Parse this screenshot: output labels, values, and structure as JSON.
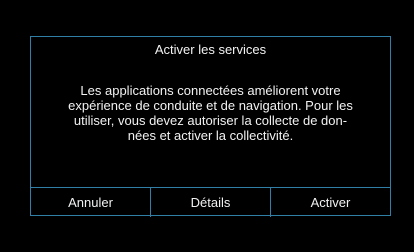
{
  "colors": {
    "background": "#000000",
    "border_accent": "#2f7fa6",
    "text": "#f2f2f2"
  },
  "dialog": {
    "title": "Activer les services",
    "message": "Les applications connectées améliorent votre\nexpérience de conduite et de navigation. Pour les\nutiliser, vous devez autoriser la collecte de don-\nnées et activer la collectivité.",
    "buttons": [
      {
        "label": "Annuler"
      },
      {
        "label": "Détails"
      },
      {
        "label": "Activer"
      }
    ]
  }
}
